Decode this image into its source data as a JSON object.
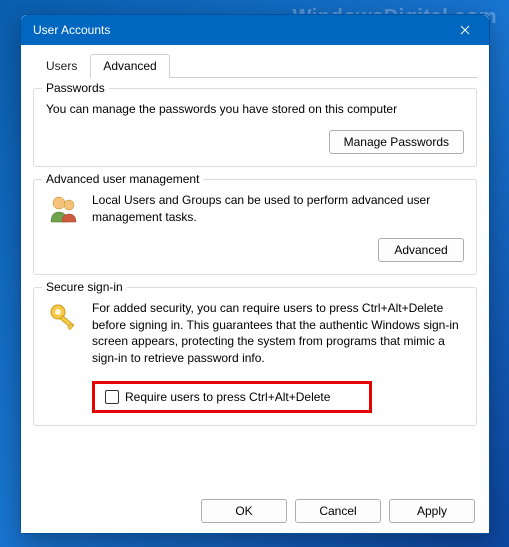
{
  "watermark": "WindowsDigital.com",
  "window": {
    "title": "User Accounts"
  },
  "tabs": [
    {
      "label": "Users"
    },
    {
      "label": "Advanced"
    }
  ],
  "groups": {
    "passwords": {
      "legend": "Passwords",
      "desc": "You can manage the passwords you have stored on this computer",
      "button": "Manage Passwords"
    },
    "advanced_mgmt": {
      "legend": "Advanced user management",
      "desc": "Local Users and Groups can be used to perform advanced user management tasks.",
      "button": "Advanced"
    },
    "secure_signin": {
      "legend": "Secure sign-in",
      "desc": "For added security, you can require users to press Ctrl+Alt+Delete before signing in. This guarantees that the authentic Windows sign-in screen appears, protecting the system from programs that mimic a sign-in to retrieve password info.",
      "checkbox_label": "Require users to press Ctrl+Alt+Delete"
    }
  },
  "footer": {
    "ok": "OK",
    "cancel": "Cancel",
    "apply": "Apply"
  }
}
